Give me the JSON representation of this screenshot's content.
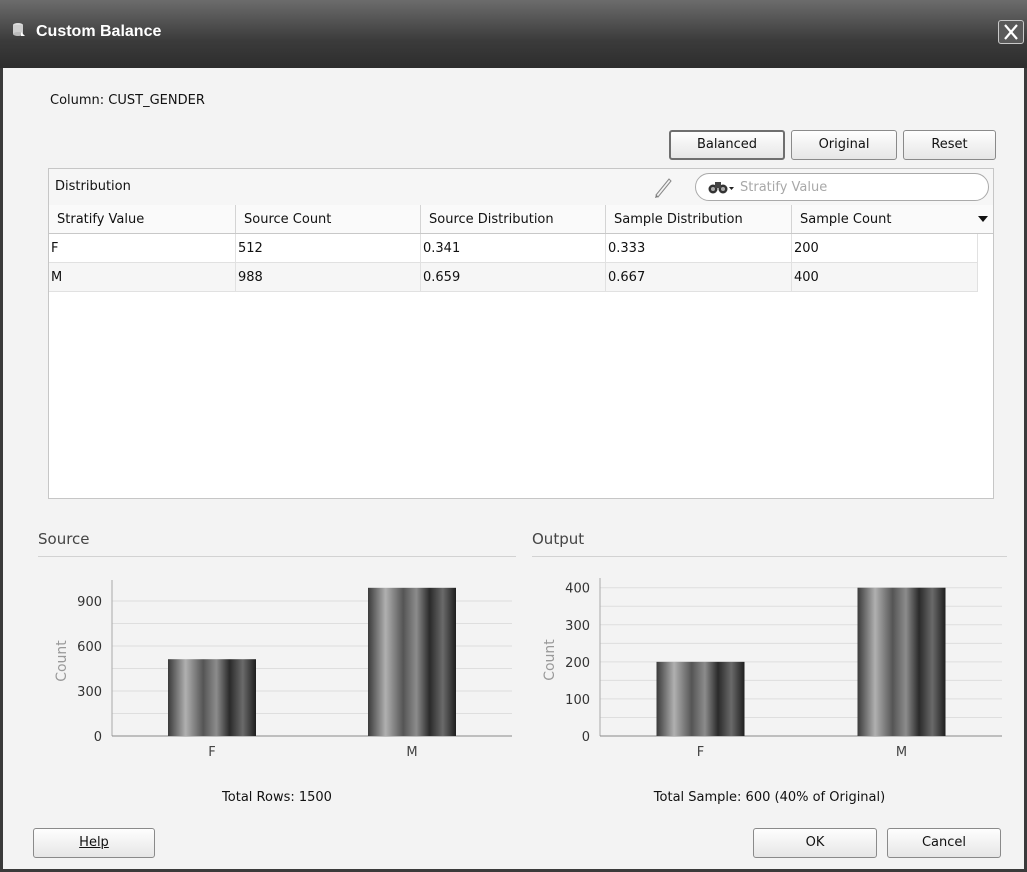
{
  "window": {
    "title": "Custom Balance",
    "icon": "database-icon",
    "close_icon": "close-icon"
  },
  "column_label": "Column:  CUST_GENDER",
  "actions": {
    "balanced": "Balanced",
    "original": "Original",
    "reset": "Reset"
  },
  "distribution": {
    "title": "Distribution",
    "edit_icon": "pencil-icon",
    "search": {
      "icon": "binoculars-icon",
      "placeholder": "Stratify Value"
    },
    "columns": [
      "Stratify Value",
      "Source Count",
      "Source Distribution",
      "Sample Distribution",
      "Sample Count"
    ],
    "rows": [
      [
        "F",
        "512",
        "0.341",
        "0.333",
        "200"
      ],
      [
        "M",
        "988",
        "0.659",
        "0.667",
        "400"
      ]
    ],
    "column_menu_icon": "dropdown-arrow-icon"
  },
  "source_chart": {
    "heading": "Source",
    "total_text": "Total Rows: 1500"
  },
  "output_chart": {
    "heading": "Output",
    "total_text": "Total Sample: 600 (40% of Original)"
  },
  "chart_data": [
    {
      "type": "bar",
      "title": "Source",
      "categories": [
        "F",
        "M"
      ],
      "values": [
        512,
        988
      ],
      "ylabel": "Count",
      "xlabel": "",
      "ylim": [
        0,
        1000
      ],
      "yticks": [
        0,
        300,
        600,
        900
      ],
      "grid": true
    },
    {
      "type": "bar",
      "title": "Output",
      "categories": [
        "F",
        "M"
      ],
      "values": [
        200,
        400
      ],
      "ylabel": "Count",
      "xlabel": "",
      "ylim": [
        0,
        410
      ],
      "yticks": [
        0,
        100,
        200,
        300,
        400
      ],
      "grid": true
    }
  ],
  "footer": {
    "help": "Help",
    "ok": "OK",
    "cancel": "Cancel"
  },
  "colors": {
    "titlebar": "#3b3b3b",
    "bar_dark": "#2e2e2e",
    "bar_light": "#9a9a9a"
  }
}
